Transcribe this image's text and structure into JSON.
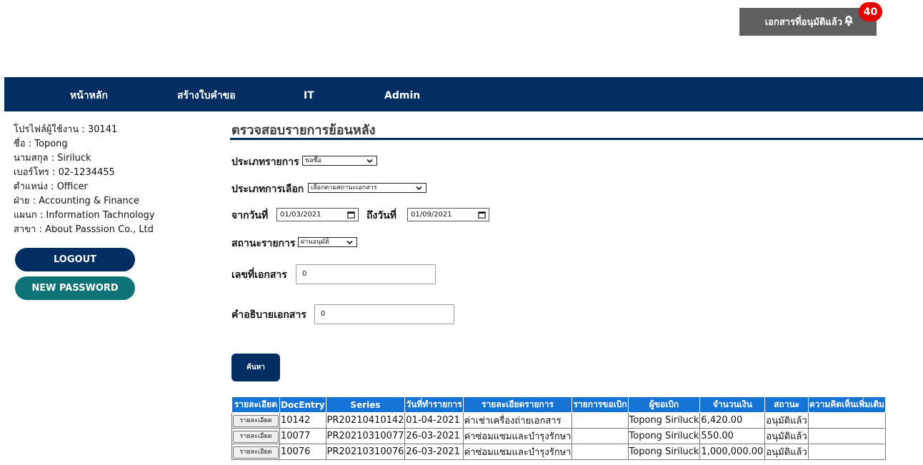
{
  "header": {
    "approved_docs_label": "เอกสารที่อนุมัติแล้ว",
    "badge_count": "40"
  },
  "nav": {
    "items": [
      {
        "label": "หน้าหลัก"
      },
      {
        "label": "สร้างใบคำขอ"
      },
      {
        "label": "IT"
      },
      {
        "label": "Admin"
      }
    ]
  },
  "profile": {
    "user_profile": "โปรไฟล์ผู้ใช้งาน : 30141",
    "first_name": "ชื่อ : Topong",
    "last_name": "นามสกุล : Siriluck",
    "phone": "เบอร์โทร : 02-1234455",
    "position": "ตำแหน่ง : Officer",
    "division": "ฝ่าย  : Accounting & Finance",
    "department": "แผนก  : Information Tachnology",
    "branch": "สาขา  : About Passsion Co., Ltd"
  },
  "buttons": {
    "logout": "LOGOUT",
    "new_password": "NEW PASSWORD",
    "search": "ค้นหา"
  },
  "page_title": "ตรวจสอบรายการย้อนหลัง",
  "form": {
    "item_type_label": "ประเภทรายการ",
    "item_type_value": "ขอซื้อ",
    "selection_type_label": "ประเภทการเลือก",
    "selection_type_value": "เลือกตามสถานะเอกสาร",
    "from_date_label": "จากวันที่",
    "from_date_value": "01/03/2021",
    "to_date_label": "ถึงวันที่",
    "to_date_value": "01/09/2021",
    "status_label": "สถานะรายการ",
    "status_value": "ผ่านอนุมัติ",
    "doc_no_label": "เลขที่เอกสาร",
    "doc_no_value": "0",
    "doc_desc_label": "คำอธิบายเอกสาร",
    "doc_desc_value": "0"
  },
  "table": {
    "headers": [
      "รายละเอียด",
      "DocEntry",
      "Series",
      "วันที่ทำรายการ",
      "รายละเอียดรายการ",
      "รายการขอเบิก",
      "ผู้ขอเบิก",
      "จำนวนเงิน",
      "สถานะ",
      "ความคิดเห็นเพิ่มเติม"
    ],
    "detail_button_label": "รายละเอียด",
    "rows": [
      {
        "docentry": "10142",
        "series": "PR20210410142",
        "date": "01-04-2021",
        "description": "ค่าเช่าเครื่องถ่ายเอกสาร",
        "request": "",
        "requester": "Topong Siriluck",
        "amount": "6,420.00",
        "status": "อนุมัติแล้ว",
        "comment": ""
      },
      {
        "docentry": "10077",
        "series": "PR20210310077",
        "date": "26-03-2021",
        "description": "ค่าซ่อมแซมและบำรุงรักษา",
        "request": "",
        "requester": "Topong Siriluck",
        "amount": "550.00",
        "status": "อนุมัติแล้ว",
        "comment": ""
      },
      {
        "docentry": "10076",
        "series": "PR20210310076",
        "date": "26-03-2021",
        "description": "ค่าซ่อมแซมและบำรุงรักษา",
        "request": "",
        "requester": "Topong Siriluck",
        "amount": "1,000,000.00",
        "status": "อนุมัติแล้ว",
        "comment": ""
      }
    ]
  },
  "colors": {
    "navy": "#002d62",
    "teal": "#0e7377",
    "table_header": "#1673d6",
    "badge": "#e60000",
    "notif_bg": "#5f5f5f"
  }
}
